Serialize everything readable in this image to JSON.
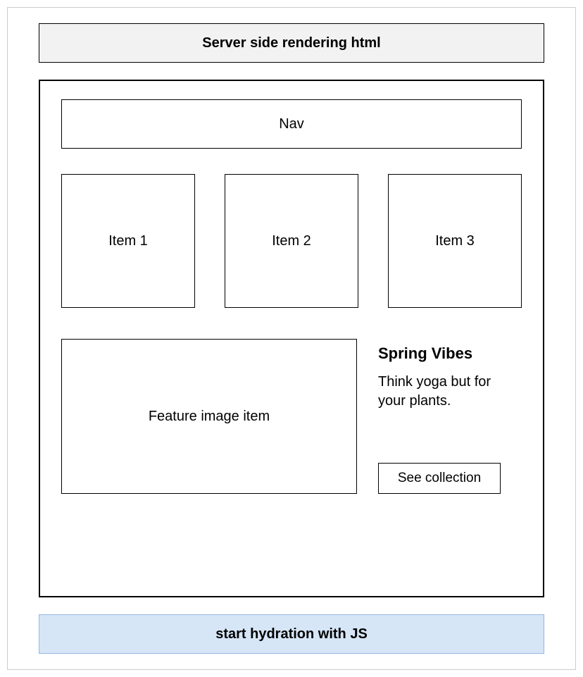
{
  "ssr_bar": {
    "label": "Server side rendering html"
  },
  "page": {
    "nav": {
      "label": "Nav"
    },
    "items": [
      {
        "label": "Item 1"
      },
      {
        "label": "Item 2"
      },
      {
        "label": "Item 3"
      }
    ],
    "feature": {
      "image_label": "Feature image item",
      "title": "Spring Vibes",
      "description": "Think yoga but for your plants.",
      "button_label": "See collection"
    }
  },
  "hydration_bar": {
    "label": "start hydration with JS"
  }
}
